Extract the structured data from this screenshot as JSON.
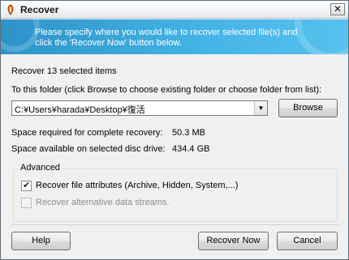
{
  "window": {
    "title": "Recover",
    "close_glyph": "✕"
  },
  "banner": {
    "text": "Please specify where you would like to recover selected file(s) and click the 'Recover Now' button below."
  },
  "summary": {
    "items_label": "Recover 13 selected items"
  },
  "destination": {
    "instruction": "To this folder (click Browse to choose existing folder or choose folder from list):",
    "folder_value": "C:¥Users¥harada¥Desktop¥復活",
    "browse_label": "Browse"
  },
  "space": {
    "required_label": "Space required for complete recovery:",
    "required_value": "50.3 MB",
    "available_label": "Space available on selected disc drive:",
    "available_value": "434.4 GB"
  },
  "advanced": {
    "legend": "Advanced",
    "options": [
      {
        "label": "Recover file attributes (Archive, Hidden, System,...)",
        "checked": true,
        "enabled": true
      },
      {
        "label": "Recover alternative data streams.",
        "checked": false,
        "enabled": false
      }
    ]
  },
  "footer": {
    "help_label": "Help",
    "recover_label": "Recover Now",
    "cancel_label": "Cancel"
  },
  "icons": {
    "app": "recover-app-icon",
    "combo_arrow": "chevron-down-icon"
  },
  "colors": {
    "banner": "#3aa8dc",
    "banner_text": "#ffffff",
    "window_bg": "#f0f0f0"
  }
}
